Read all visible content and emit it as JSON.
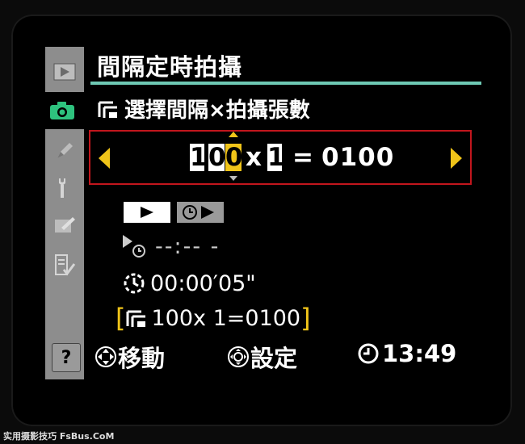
{
  "menu": {
    "title": "間隔定時拍攝",
    "subtitle": "選擇間隔×拍攝張數",
    "sidebar": [
      {
        "icon": "playback-icon"
      },
      {
        "icon": "camera-icon",
        "active": true
      },
      {
        "icon": "pencil-icon"
      },
      {
        "icon": "wrench-icon"
      },
      {
        "icon": "retouch-icon"
      },
      {
        "icon": "my-menu-icon"
      }
    ],
    "help": "?"
  },
  "selector": {
    "digits": [
      "1",
      "0",
      "0"
    ],
    "times": "x",
    "count": "1",
    "equals": "=",
    "total": "0100"
  },
  "info": {
    "start_time": "--:-- -",
    "interval": "00:00′05\"",
    "shots_prefix": "100",
    "shots_mid": " x 1=0100"
  },
  "footer": {
    "move": "移動",
    "set": "設定",
    "clock": "13:49"
  },
  "watermark": "实用摄影技巧 FsBus.CoM",
  "colors": {
    "accent": "#f0c419",
    "rule": "#6ec9b4",
    "frame": "#c2161d",
    "active_tab": "#2ec27e"
  }
}
